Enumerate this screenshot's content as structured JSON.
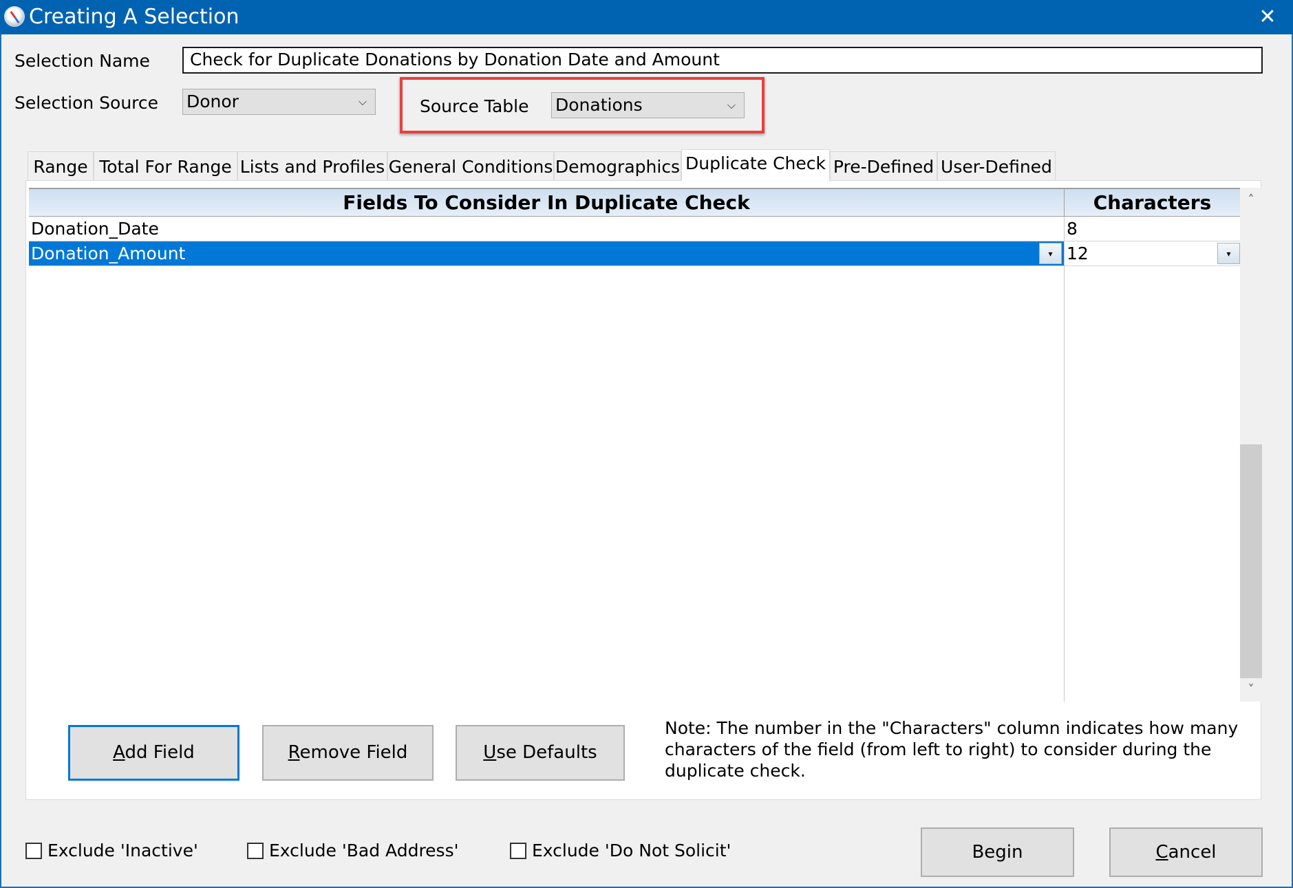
{
  "window": {
    "title": "Creating A Selection",
    "icon": "compass-icon",
    "close_label": "✕"
  },
  "form": {
    "selection_name_label": "Selection Name",
    "selection_name_value": "Check for Duplicate Donations by Donation Date and Amount",
    "selection_source_label": "Selection Source",
    "selection_source_value": "Donor",
    "source_table_label": "Source Table",
    "source_table_value": "Donations",
    "chevron": "⌵"
  },
  "tabs": [
    {
      "label": "Range",
      "active": false
    },
    {
      "label": "Total For Range",
      "active": false
    },
    {
      "label": "Lists and Profiles",
      "active": false
    },
    {
      "label": "General Conditions",
      "active": false
    },
    {
      "label": "Demographics",
      "active": false
    },
    {
      "label": "Duplicate Check",
      "active": true
    },
    {
      "label": "Pre-Defined",
      "active": false
    },
    {
      "label": "User-Defined",
      "active": false
    }
  ],
  "grid": {
    "columns": [
      "Fields To Consider In Duplicate Check",
      "Characters"
    ],
    "rows": [
      {
        "field": "Donation_Date",
        "characters": "8",
        "selected": false
      },
      {
        "field": "Donation_Amount",
        "characters": "12",
        "selected": true
      }
    ],
    "dropdown_glyph": "▾",
    "scroll_up": "˄",
    "scroll_down": "˅"
  },
  "actions": {
    "add_field": {
      "accel": "A",
      "rest": "dd Field"
    },
    "remove_field": {
      "accel": "R",
      "rest": "emove Field"
    },
    "use_defaults": {
      "accel": "U",
      "rest": "se Defaults"
    }
  },
  "note": "Note:  The number in the \"Characters\" column indicates how many characters of the field (from left to right) to consider during the duplicate check.",
  "footer": {
    "exclude_inactive": {
      "label": "Exclude 'Inactive'",
      "checked": false
    },
    "exclude_bad_address": {
      "label": "Exclude 'Bad Address'",
      "checked": false
    },
    "exclude_do_not_solicit": {
      "label": "Exclude 'Do Not Solicit'",
      "checked": false
    },
    "begin_label": "Begin",
    "cancel": {
      "accel": "C",
      "rest": "ancel"
    }
  },
  "colors": {
    "titlebar": "#0063b1",
    "selection": "#0078d7",
    "highlight_box": "#e84040"
  }
}
